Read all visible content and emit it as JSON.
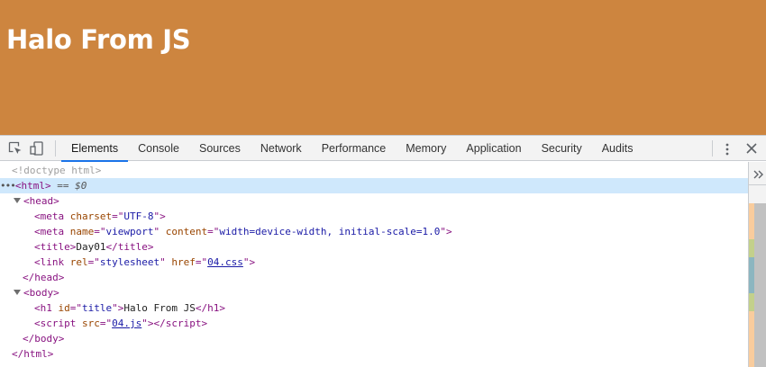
{
  "page": {
    "heading": "Halo From JS",
    "background_color": "#cd853f"
  },
  "devtools": {
    "toolbar": {
      "inspect_icon": "inspect-element-icon",
      "device_icon": "device-toolbar-icon",
      "tabs": [
        {
          "label": "Elements",
          "active": true
        },
        {
          "label": "Console",
          "active": false
        },
        {
          "label": "Sources",
          "active": false
        },
        {
          "label": "Network",
          "active": false
        },
        {
          "label": "Performance",
          "active": false
        },
        {
          "label": "Memory",
          "active": false
        },
        {
          "label": "Application",
          "active": false
        },
        {
          "label": "Security",
          "active": false
        },
        {
          "label": "Audits",
          "active": false
        }
      ],
      "menu_icon": "kebab-menu-icon",
      "close_icon": "close-icon",
      "accent_color": "#1a73e8"
    },
    "tree": {
      "doctype": "<!doctype html>",
      "selected_marker": "== $0",
      "head_meta_charset": "UTF-8",
      "head_meta_name": "viewport",
      "head_meta_content": "width=device-width, initial-scale=1.0",
      "title_text": "Day01",
      "link_rel": "stylesheet",
      "link_href": "04.css",
      "h1_id": "title",
      "h1_text": "Halo From JS",
      "script_src": "04.js"
    },
    "side_panel": {
      "expand_icon": "chevron-double-right-icon"
    }
  }
}
